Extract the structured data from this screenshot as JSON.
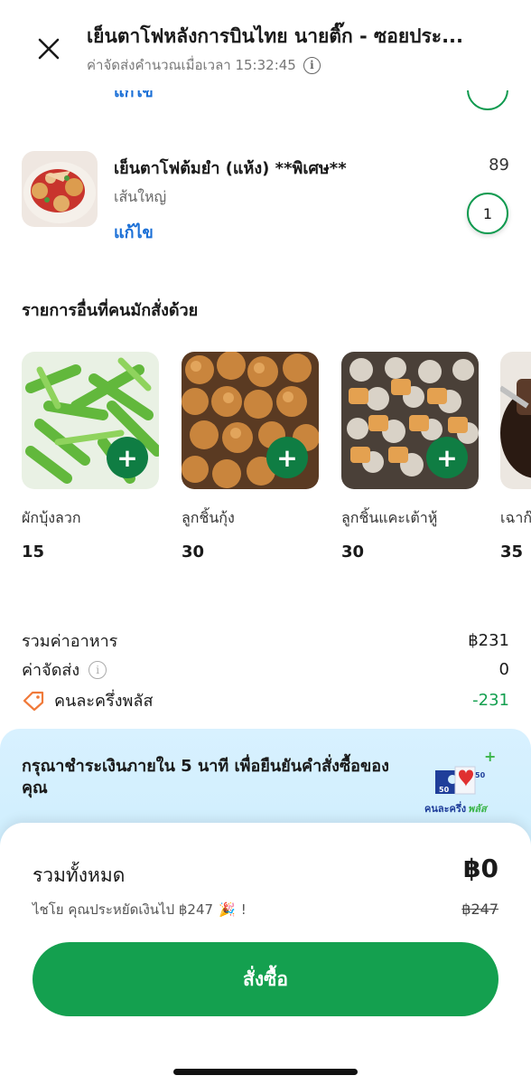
{
  "header": {
    "title": "เย็นตาโฟหลังการบินไทย นายติ๊ก - ซอยประ...",
    "subtitle": "ค่าจัดส่งคำนวณเมื่อเวลา 15:32:45"
  },
  "prev_item": {
    "edit_label": "แก้ไข"
  },
  "cart_item": {
    "name": "เย็นตาโฟต้มยำ (แห้ง) **พิเศษ**",
    "option": "เส้นใหญ่",
    "price": "89",
    "edit_label": "แก้ไข",
    "quantity": "1"
  },
  "recommendations": {
    "title": "รายการอื่นที่คนมักสั่งด้วย",
    "items": [
      {
        "name": "ผักบุ้งลวก",
        "price": "15"
      },
      {
        "name": "ลูกชิ้นกุ้ง",
        "price": "30"
      },
      {
        "name": "ลูกชิ้นแคะเต้าหู้",
        "price": "30"
      },
      {
        "name": "เฉาก๊",
        "price": "35"
      }
    ]
  },
  "summary": {
    "food_label": "รวมค่าอาหาร",
    "food_value": "฿231",
    "delivery_label": "ค่าจัดส่ง",
    "delivery_value": "0",
    "discount_label": "คนละครึ่งพลัส",
    "discount_value": "-231"
  },
  "banner": {
    "text": "กรุณาชำระเงินภายใน 5 นาที เพื่อยืนยันคำสั่งซื้อของคุณ",
    "logo_text": "คนละครึ่ง",
    "logo_text_plus": "พลัส",
    "logo_num": "50"
  },
  "checkout": {
    "total_label": "รวมทั้งหมด",
    "total_value": "฿0",
    "saving_text": "ไชโย คุณประหยัดเงินไป ฿247",
    "saving_emoji": "🎉",
    "saving_suffix": "!",
    "original_total": "฿247",
    "order_button": "สั่งซื้อ"
  },
  "colors": {
    "accent": "#14a04f",
    "link": "#1a6fd6",
    "banner_bg": "#d8f1ff"
  }
}
